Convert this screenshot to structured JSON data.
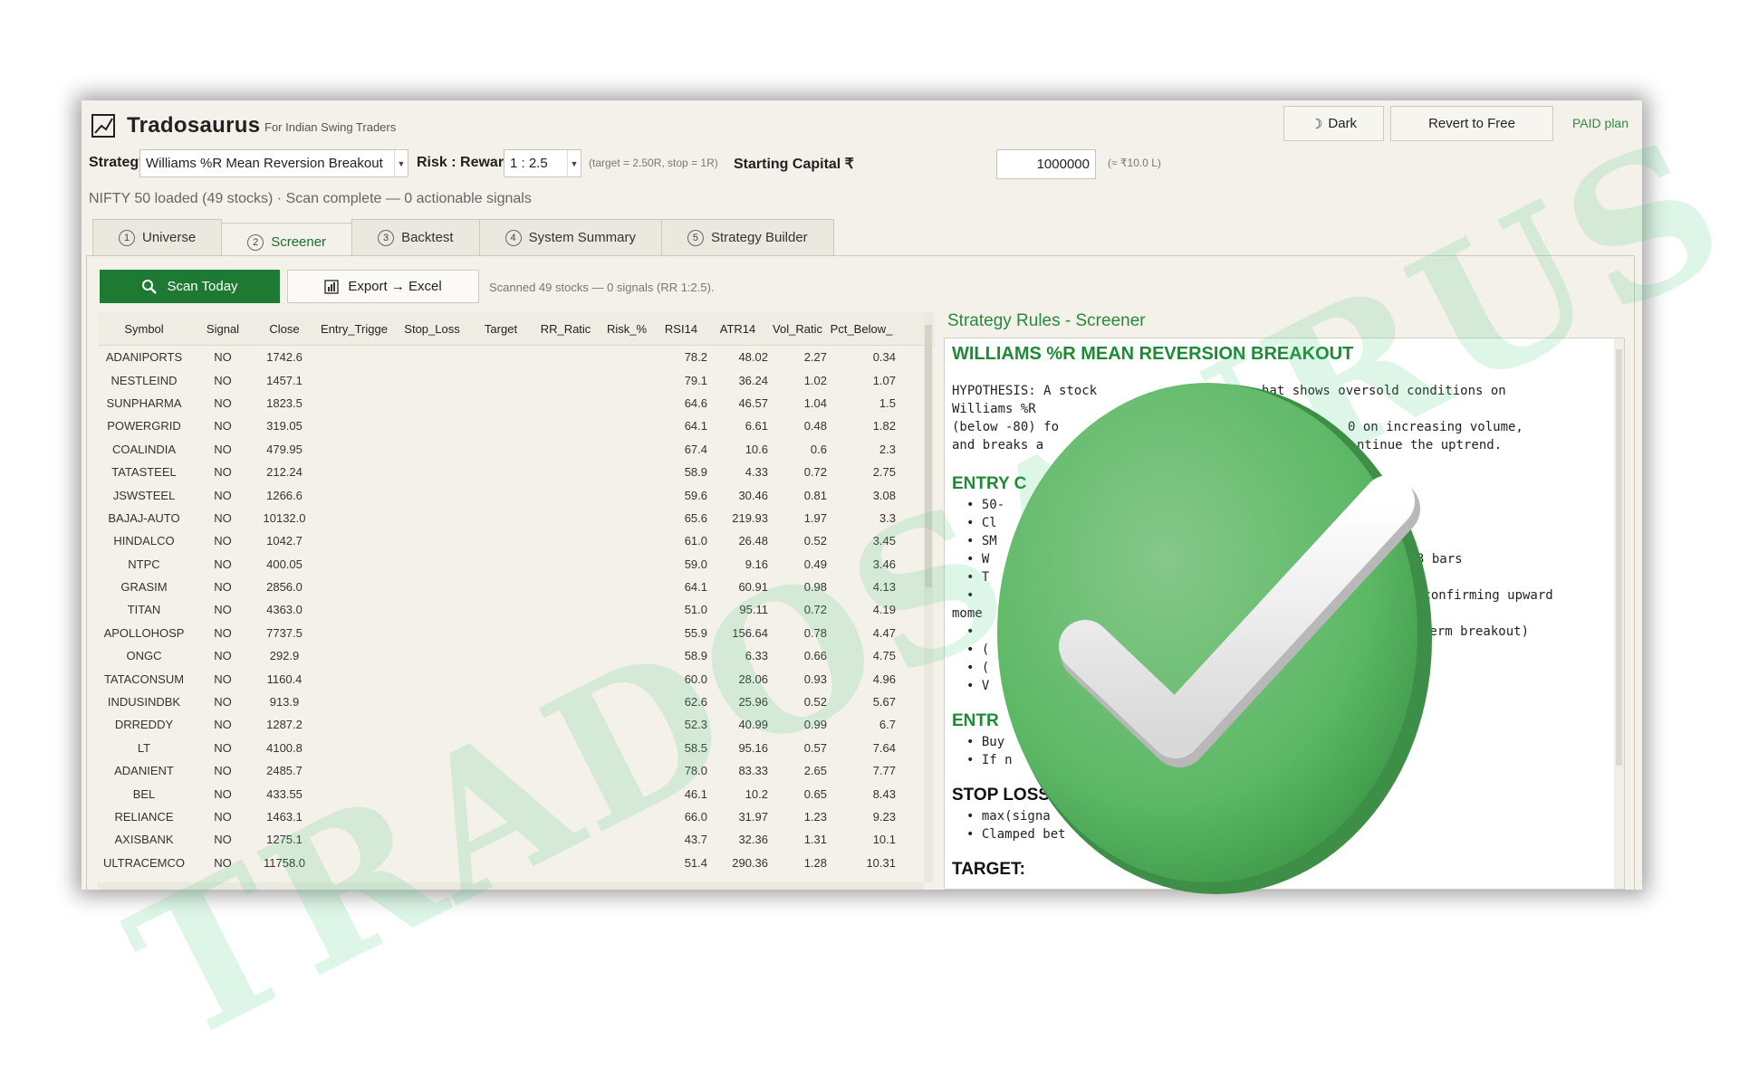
{
  "app": {
    "title": "Tradosaurus",
    "subtitle": "For Indian Swing Traders",
    "dark_button": "Dark",
    "revert_button": "Revert to Free",
    "plan": "PAID plan"
  },
  "controls": {
    "strategy_label": "Strategy",
    "strategy_value": "Williams %R Mean Reversion Breakout",
    "rr_label": "Risk : Reward",
    "rr_value": "1 : 2.5",
    "rr_hint": "(target = 2.50R, stop = 1R)",
    "capital_label": "Starting Capital ₹",
    "capital_value": "1000000",
    "capital_hint": "(≈ ₹10.0 L)"
  },
  "status": "NIFTY 50 loaded (49 stocks) · Scan complete — 0 actionable signals",
  "tabs": [
    {
      "num": "1",
      "label": "Universe"
    },
    {
      "num": "2",
      "label": "Screener"
    },
    {
      "num": "3",
      "label": "Backtest"
    },
    {
      "num": "4",
      "label": "System Summary"
    },
    {
      "num": "5",
      "label": "Strategy Builder"
    }
  ],
  "screener": {
    "scan_button": "Scan Today",
    "export_button": "Export → Excel",
    "scan_status": "Scanned 49 stocks — 0 signals (RR 1:2.5).",
    "columns": [
      "Symbol",
      "Signal",
      "Close",
      "Entry_Trigge",
      "Stop_Loss",
      "Target",
      "RR_Ratic",
      "Risk_%",
      "RSI14",
      "ATR14",
      "Vol_Ratic",
      "Pct_Below_"
    ],
    "rows": [
      [
        "ADANIPORTS",
        "NO",
        "1742.6",
        "78.2",
        "48.02",
        "2.27",
        "0.34"
      ],
      [
        "NESTLEIND",
        "NO",
        "1457.1",
        "79.1",
        "36.24",
        "1.02",
        "1.07"
      ],
      [
        "SUNPHARMA",
        "NO",
        "1823.5",
        "64.6",
        "46.57",
        "1.04",
        "1.5"
      ],
      [
        "POWERGRID",
        "NO",
        "319.05",
        "64.1",
        "6.61",
        "0.48",
        "1.82"
      ],
      [
        "COALINDIA",
        "NO",
        "479.95",
        "67.4",
        "10.6",
        "0.6",
        "2.3"
      ],
      [
        "TATASTEEL",
        "NO",
        "212.24",
        "58.9",
        "4.33",
        "0.72",
        "2.75"
      ],
      [
        "JSWSTEEL",
        "NO",
        "1266.6",
        "59.6",
        "30.46",
        "0.81",
        "3.08"
      ],
      [
        "BAJAJ-AUTO",
        "NO",
        "10132.0",
        "65.6",
        "219.93",
        "1.97",
        "3.3"
      ],
      [
        "HINDALCO",
        "NO",
        "1042.7",
        "61.0",
        "26.48",
        "0.52",
        "3.45"
      ],
      [
        "NTPC",
        "NO",
        "400.05",
        "59.0",
        "9.16",
        "0.49",
        "3.46"
      ],
      [
        "GRASIM",
        "NO",
        "2856.0",
        "64.1",
        "60.91",
        "0.98",
        "4.13"
      ],
      [
        "TITAN",
        "NO",
        "4363.0",
        "51.0",
        "95.11",
        "0.72",
        "4.19"
      ],
      [
        "APOLLOHOSP",
        "NO",
        "7737.5",
        "55.9",
        "156.64",
        "0.78",
        "4.47"
      ],
      [
        "ONGC",
        "NO",
        "292.9",
        "58.9",
        "6.33",
        "0.66",
        "4.75"
      ],
      [
        "TATACONSUM",
        "NO",
        "1160.4",
        "60.0",
        "28.06",
        "0.93",
        "4.96"
      ],
      [
        "INDUSINDBK",
        "NO",
        "913.9",
        "62.6",
        "25.96",
        "0.52",
        "5.67"
      ],
      [
        "DRREDDY",
        "NO",
        "1287.2",
        "52.3",
        "40.99",
        "0.99",
        "6.7"
      ],
      [
        "LT",
        "NO",
        "4100.8",
        "58.5",
        "95.16",
        "0.57",
        "7.64"
      ],
      [
        "ADANIENT",
        "NO",
        "2485.7",
        "78.0",
        "83.33",
        "2.65",
        "7.77"
      ],
      [
        "BEL",
        "NO",
        "433.55",
        "46.1",
        "10.2",
        "0.65",
        "8.43"
      ],
      [
        "RELIANCE",
        "NO",
        "1463.1",
        "66.0",
        "31.97",
        "1.23",
        "9.23"
      ],
      [
        "AXISBANK",
        "NO",
        "1275.1",
        "43.7",
        "32.36",
        "1.31",
        "10.1"
      ],
      [
        "ULTRACEMCO",
        "NO",
        "11758.0",
        "51.4",
        "290.36",
        "1.28",
        "10.31"
      ]
    ]
  },
  "rules": {
    "panel_title": "Strategy Rules - Screener",
    "heading": "WILLIAMS %R MEAN REVERSION BREAKOUT",
    "hyp_1": "HYPOTHESIS: A stock",
    "hyp_1b": "hat shows oversold conditions on",
    "hyp_2": "Williams %R",
    "hyp_3": "(below -80) fo",
    "hyp_3b": "0 on increasing volume,",
    "hyp_4": "and breaks a",
    "hyp_4b": "ntinue the uptrend.",
    "entry_heading": "ENTRY C",
    "bullets_a": [
      "• 50-",
      "• Cl",
      "• SM",
      "• W",
      "• T",
      "• "
    ],
    "frag_3bars": "3 bars",
    "frag_confirm": "(confirming upward",
    "frag_mome": "mome",
    "bullets_b": [
      "• ",
      "• (",
      "• (",
      "• V"
    ],
    "frag_term": "term breakout)",
    "entr_heading": "ENTR",
    "buy_1": "• Buy",
    "buy_2": "• If n",
    "stop_heading": "STOP LOSS",
    "stop_1": "• max(signa",
    "stop_2": "• Clamped bet",
    "target_heading": "TARGET:"
  },
  "watermark": "TRADOSAURUS",
  "colors": {
    "accent": "#1e7a33",
    "badge": "#5cb865",
    "watermark": "#3cc878"
  }
}
